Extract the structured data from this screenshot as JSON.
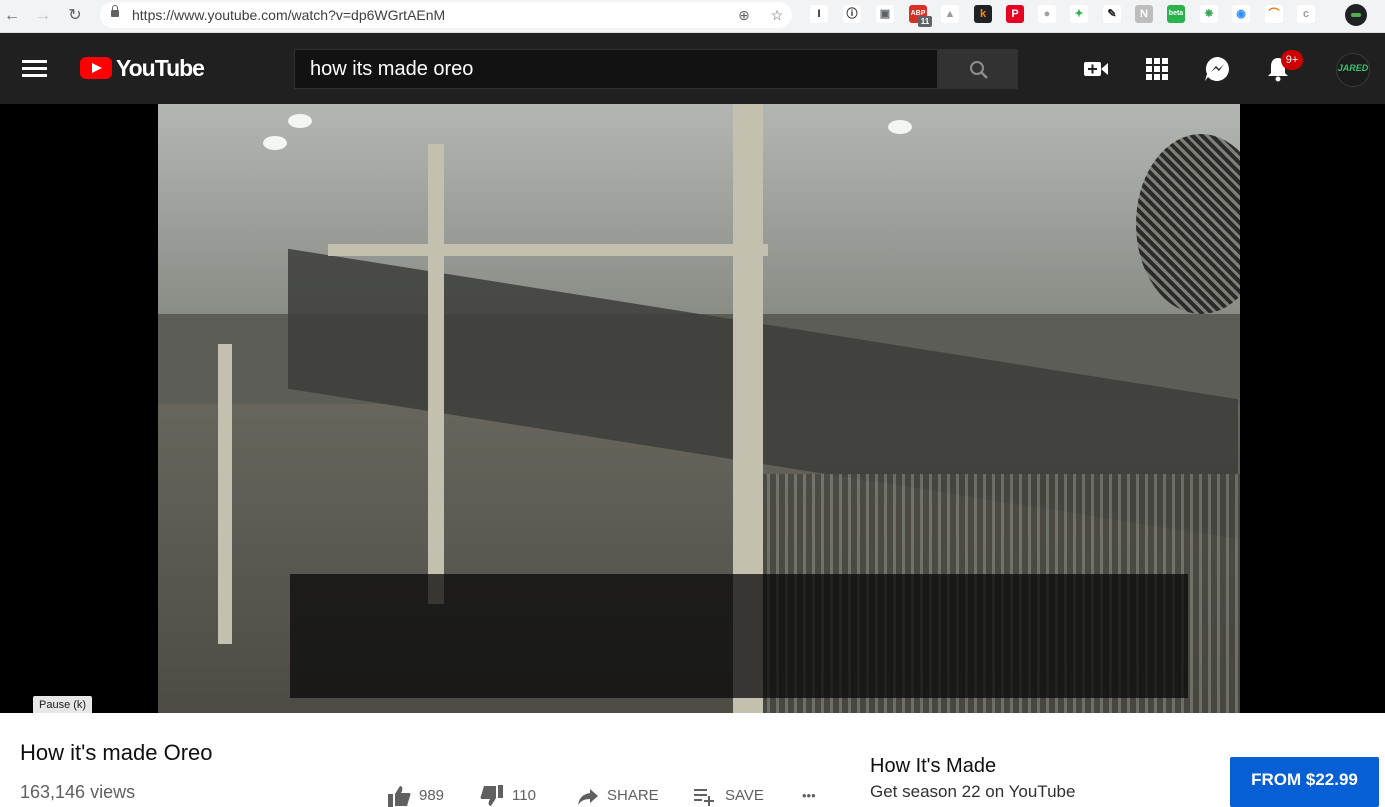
{
  "browser": {
    "url": "https://www.youtube.com/watch?v=dp6WGrtAEnM",
    "extensions": [
      {
        "name": "instapaper-extension",
        "text": "I",
        "color": "#ffffff",
        "fg": "#202124"
      },
      {
        "name": "1password-extension",
        "text": "ⓘ",
        "color": "#ffffff",
        "fg": "#202124"
      },
      {
        "name": "camera-extension",
        "text": "▣",
        "color": "#ffffff",
        "fg": "#5f6368"
      },
      {
        "name": "adblock-extension",
        "text": "ABP",
        "color": "#d93025",
        "fg": "#ffffff"
      },
      {
        "name": "drive-extension",
        "text": "▲",
        "color": "#ffffff",
        "fg": "#9aa0a6"
      },
      {
        "name": "k-extension",
        "text": "k",
        "color": "#202124",
        "fg": "#ff8a00"
      },
      {
        "name": "pinterest-extension",
        "text": "P",
        "color": "#e60023",
        "fg": "#ffffff"
      },
      {
        "name": "dot-extension",
        "text": "●",
        "color": "#ffffff",
        "fg": "#9aa0a6"
      },
      {
        "name": "feedly-extension",
        "text": "✦",
        "color": "#ffffff",
        "fg": "#2bb24c"
      },
      {
        "name": "pen-extension",
        "text": "✎",
        "color": "#ffffff",
        "fg": "#202124"
      },
      {
        "name": "notion-extension",
        "text": "N",
        "color": "#bdbdbd",
        "fg": "#ffffff"
      },
      {
        "name": "beta-extension",
        "text": "beta",
        "color": "#2bb24c",
        "fg": "#ffffff"
      },
      {
        "name": "puzzle-extension",
        "text": "✵",
        "color": "#ffffff",
        "fg": "#34a853"
      },
      {
        "name": "zoom-extension",
        "text": "◉",
        "color": "#ffffff",
        "fg": "#2d8cff"
      },
      {
        "name": "arc-extension",
        "text": "⌒",
        "color": "#ffffff",
        "fg": "#e37400"
      },
      {
        "name": "c-extension",
        "text": "c",
        "color": "#ffffff",
        "fg": "#9aa0a6"
      }
    ],
    "adblock_count": "11",
    "profile_label": "JARED"
  },
  "youtube": {
    "logo_text": "YouTube",
    "search_query": "how its made oreo",
    "notification_count": "9+",
    "avatar_text": "JARED"
  },
  "player": {
    "caption": "",
    "tooltip": "Pause (k)"
  },
  "video": {
    "title": "How it's made Oreo",
    "views": "163,146 views",
    "like_count": "989",
    "dislike_count": "110",
    "share_label": "SHARE",
    "save_label": "SAVE",
    "more_label": "•••"
  },
  "promo": {
    "channel": "How It's Made",
    "text": "Get season 22 on YouTube",
    "price_label": "FROM $22.99"
  },
  "colors": {
    "header_bg": "#202020",
    "brand_red": "#ff0000",
    "button_blue": "#065fd4",
    "badge_red": "#cc0000"
  }
}
